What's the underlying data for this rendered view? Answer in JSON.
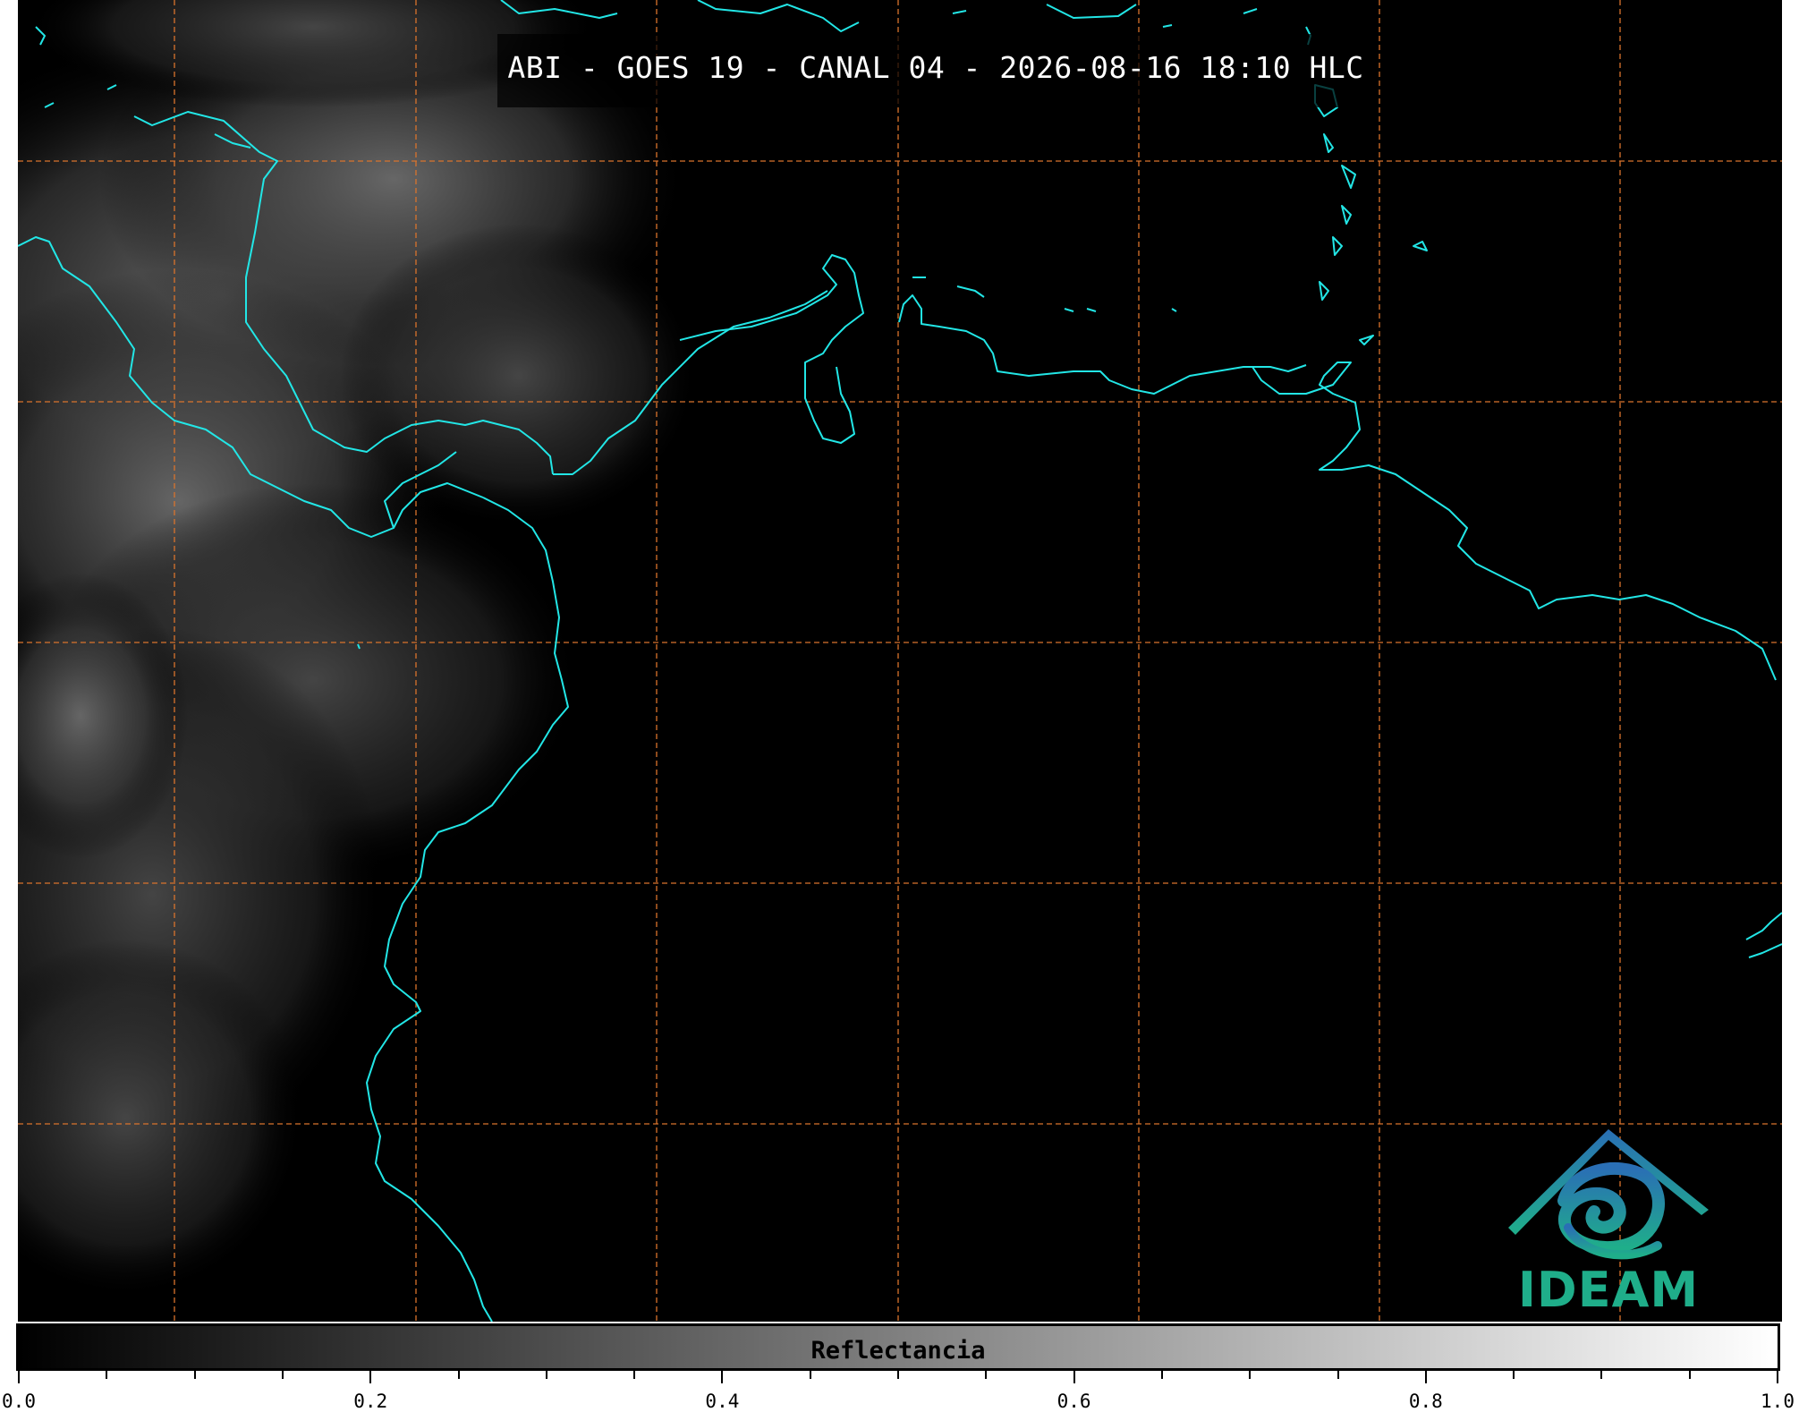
{
  "map": {
    "title": "ABI - GOES 19 - CANAL 04 - 2026-08-16 18:10 HLC",
    "coastline_color": "#22e6e6",
    "gridline_color": "#d9732c",
    "background_color": "#000000"
  },
  "logo": {
    "text": "IDEAM",
    "icon": "ideam-andes-spiral-icon",
    "colors": [
      "#2a6fb5",
      "#1fae8a"
    ]
  },
  "colorbar": {
    "label": "Reflectancia",
    "min": 0.0,
    "max": 1.0,
    "gradient": [
      "#000000",
      "#ffffff"
    ],
    "tick_labels": [
      "0.0",
      "0.2",
      "0.4",
      "0.6",
      "0.8",
      "1.0"
    ]
  }
}
